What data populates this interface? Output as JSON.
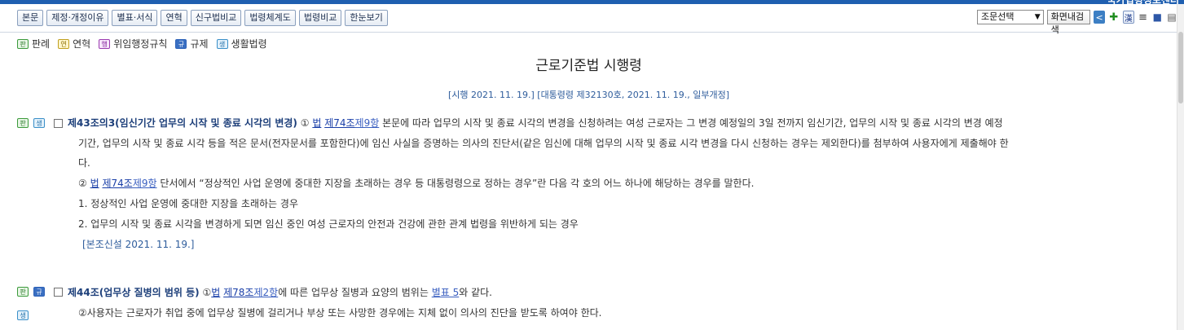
{
  "header": {
    "brand": "국가법령정보센터"
  },
  "toolbar": {
    "tabs": [
      "본문",
      "제정·개정이유",
      "별표·서식",
      "연혁",
      "신구법비교",
      "법령체계도",
      "법령비교",
      "한눈보기"
    ],
    "article_select": "조문선택",
    "search_button": "화면내검색",
    "icons": [
      "share-icon",
      "puzzle-icon",
      "hanja-icon",
      "document-icon",
      "save-icon",
      "print-icon"
    ]
  },
  "legend": [
    {
      "badge": "판",
      "label": "판례"
    },
    {
      "badge": "연",
      "label": "연혁"
    },
    {
      "badge": "행",
      "label": "위임행정규칙"
    },
    {
      "badge": "규",
      "label": "규제"
    },
    {
      "badge": "생",
      "label": "생활법령"
    }
  ],
  "law": {
    "title": "근로기준법 시행령",
    "enforcement": "[시행 2021. 11. 19.] [대통령령 제32130호, 2021. 11. 19., 일부개정]"
  },
  "articles": [
    {
      "badges": [
        "판",
        "생"
      ],
      "title": "제43조의3(임신기간 업무의 시작 및 종료 시각의 변경)",
      "p1_num": "①",
      "p1_ref_law": "법",
      "p1_ref_art": "제74조",
      "p1_ref_para": "제9항",
      "p1_text_a": "본문에 따라 업무의 시작 및 종료 시각의 변경을 신청하려는 여성 근로자는 그 변경 예정일의 3일 전까지 임신기간, 업무의 시작 및 종료 시각의 변경 예정",
      "p1_text_b": "기간, 업무의 시작 및 종료 시각 등을 적은 문서(전자문서를 포함한다)에 임신 사실을 증명하는 의사의 진단서(같은 임신에 대해 업무의 시작 및 종료 시각 변경을 다시 신청하는 경우는 제외한다)를 첨부하여 사용자에게 제출해야 한",
      "p1_text_c": "다.",
      "p2_num": "②",
      "p2_ref_law": "법",
      "p2_ref_art": "제74조",
      "p2_ref_para": "제9항",
      "p2_text": "단서에서 “정상적인 사업 운영에 중대한 지장을 초래하는 경우 등 대통령령으로 정하는 경우”란 다음 각 호의 어느 하나에 해당하는 경우를 말한다.",
      "item1": "1. 정상적인 사업 운영에 중대한 지장을 초래하는 경우",
      "item2": "2. 업무의 시작 및 종료 시각을 변경하게 되면 임신 중인 여성 근로자의 안전과 건강에 관한 관계 법령을 위반하게 되는 경우",
      "amend": "[본조신설 2021. 11. 19.]"
    },
    {
      "badges": [
        "판",
        "규",
        "생"
      ],
      "title": "제44조(업무상 질병의 범위 등)",
      "p1_num": "①",
      "p1_ref_law": "법",
      "p1_ref_art": "제78조",
      "p1_ref_para": "제2항",
      "p1_text_a": "에 따른 업무상 질병과 요양의 범위는",
      "p1_ref_table": "별표 5",
      "p1_text_b": "와 같다.",
      "p2_text": "②사용자는 근로자가 취업 중에 업무상 질병에 걸리거나 부상 또는 사망한 경우에는 지체 없이 의사의 진단을 받도록 하여야 한다."
    }
  ]
}
